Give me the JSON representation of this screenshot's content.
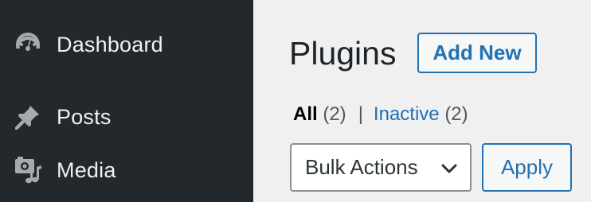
{
  "sidebar": {
    "items": [
      {
        "label": "Dashboard",
        "icon": "dashboard-icon"
      },
      {
        "label": "Posts",
        "icon": "pushpin-icon"
      },
      {
        "label": "Media",
        "icon": "media-icon"
      }
    ]
  },
  "main": {
    "title": "Plugins",
    "add_new_label": "Add New",
    "filters": {
      "all_label": "All",
      "all_count": "(2)",
      "separator": "|",
      "inactive_label": "Inactive",
      "inactive_count": "(2)"
    },
    "bulk_actions": {
      "selected": "Bulk Actions"
    },
    "apply_label": "Apply"
  },
  "colors": {
    "sidebar_bg": "#23282d",
    "page_bg": "#f0f0f1",
    "accent": "#2271b1",
    "text": "#1d2327"
  }
}
